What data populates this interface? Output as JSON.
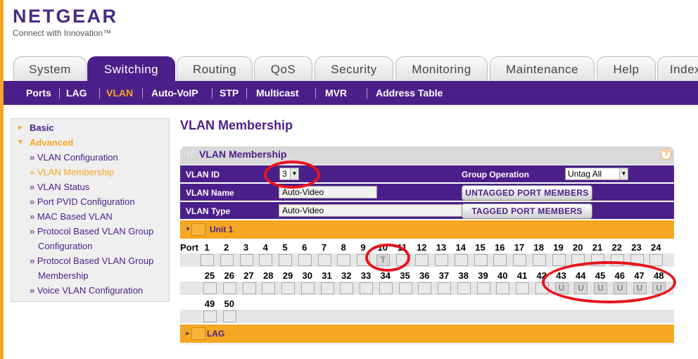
{
  "brand": {
    "name": "NETGEAR",
    "tagline": "Connect with Innovation™"
  },
  "tabs": [
    {
      "label": "System",
      "active": false
    },
    {
      "label": "Switching",
      "active": true
    },
    {
      "label": "Routing",
      "active": false
    },
    {
      "label": "QoS",
      "active": false
    },
    {
      "label": "Security",
      "active": false
    },
    {
      "label": "Monitoring",
      "active": false
    },
    {
      "label": "Maintenance",
      "active": false
    },
    {
      "label": "Help",
      "active": false
    },
    {
      "label": "Index",
      "active": false
    }
  ],
  "subnav": [
    {
      "label": "Ports",
      "active": false
    },
    {
      "label": "LAG",
      "active": false
    },
    {
      "label": "VLAN",
      "active": true
    },
    {
      "label": "Auto-VoIP",
      "active": false
    },
    {
      "label": "STP",
      "active": false
    },
    {
      "label": "Multicast",
      "active": false
    },
    {
      "label": "MVR",
      "active": false
    },
    {
      "label": "Address Table",
      "active": false
    }
  ],
  "sidebar": {
    "basic": "Basic",
    "advanced": "Advanced",
    "items": [
      {
        "label": "» VLAN Configuration",
        "active": false
      },
      {
        "label": "» VLAN Membership",
        "active": true
      },
      {
        "label": "» VLAN Status",
        "active": false
      },
      {
        "label": "» Port PVID Configuration",
        "active": false
      },
      {
        "label": "» MAC Based VLAN",
        "active": false
      },
      {
        "label": "» Protocol Based VLAN Group",
        "cont": "Configuration",
        "active": false
      },
      {
        "label": "» Protocol Based VLAN Group",
        "cont": "Membership",
        "active": false
      },
      {
        "label": "» Voice VLAN Configuration",
        "active": false
      }
    ]
  },
  "page": {
    "title": "VLAN Membership",
    "panel_title": "VLAN Membership",
    "help": "?"
  },
  "form": {
    "vlan_id_label": "VLAN ID",
    "vlan_id": "3",
    "group_op_label": "Group Operation",
    "group_op": "Untag All",
    "vlan_name_label": "VLAN Name",
    "vlan_name": "Auto-Video",
    "vlan_type_label": "VLAN Type",
    "vlan_type": "Auto-Video",
    "untagged_btn": "UNTAGGED PORT MEMBERS",
    "tagged_btn": "TAGGED PORT MEMBERS"
  },
  "unit": {
    "label": "Unit 1",
    "port_label": "Port"
  },
  "lag": {
    "label": "LAG"
  },
  "ports": {
    "row1": [
      "1",
      "2",
      "3",
      "4",
      "5",
      "6",
      "7",
      "8",
      "9",
      "10",
      "11",
      "12",
      "13",
      "14",
      "15",
      "16",
      "17",
      "18",
      "19",
      "20",
      "21",
      "22",
      "23",
      "24"
    ],
    "row2": [
      "25",
      "26",
      "27",
      "28",
      "29",
      "30",
      "31",
      "32",
      "33",
      "34",
      "35",
      "36",
      "37",
      "38",
      "39",
      "40",
      "41",
      "42",
      "43",
      "44",
      "45",
      "46",
      "47",
      "48"
    ],
    "row3": [
      "49",
      "50"
    ],
    "marks": {
      "10": "T",
      "44": "U",
      "45": "U",
      "46": "U",
      "47": "U",
      "48": "U",
      "43": "U"
    }
  }
}
